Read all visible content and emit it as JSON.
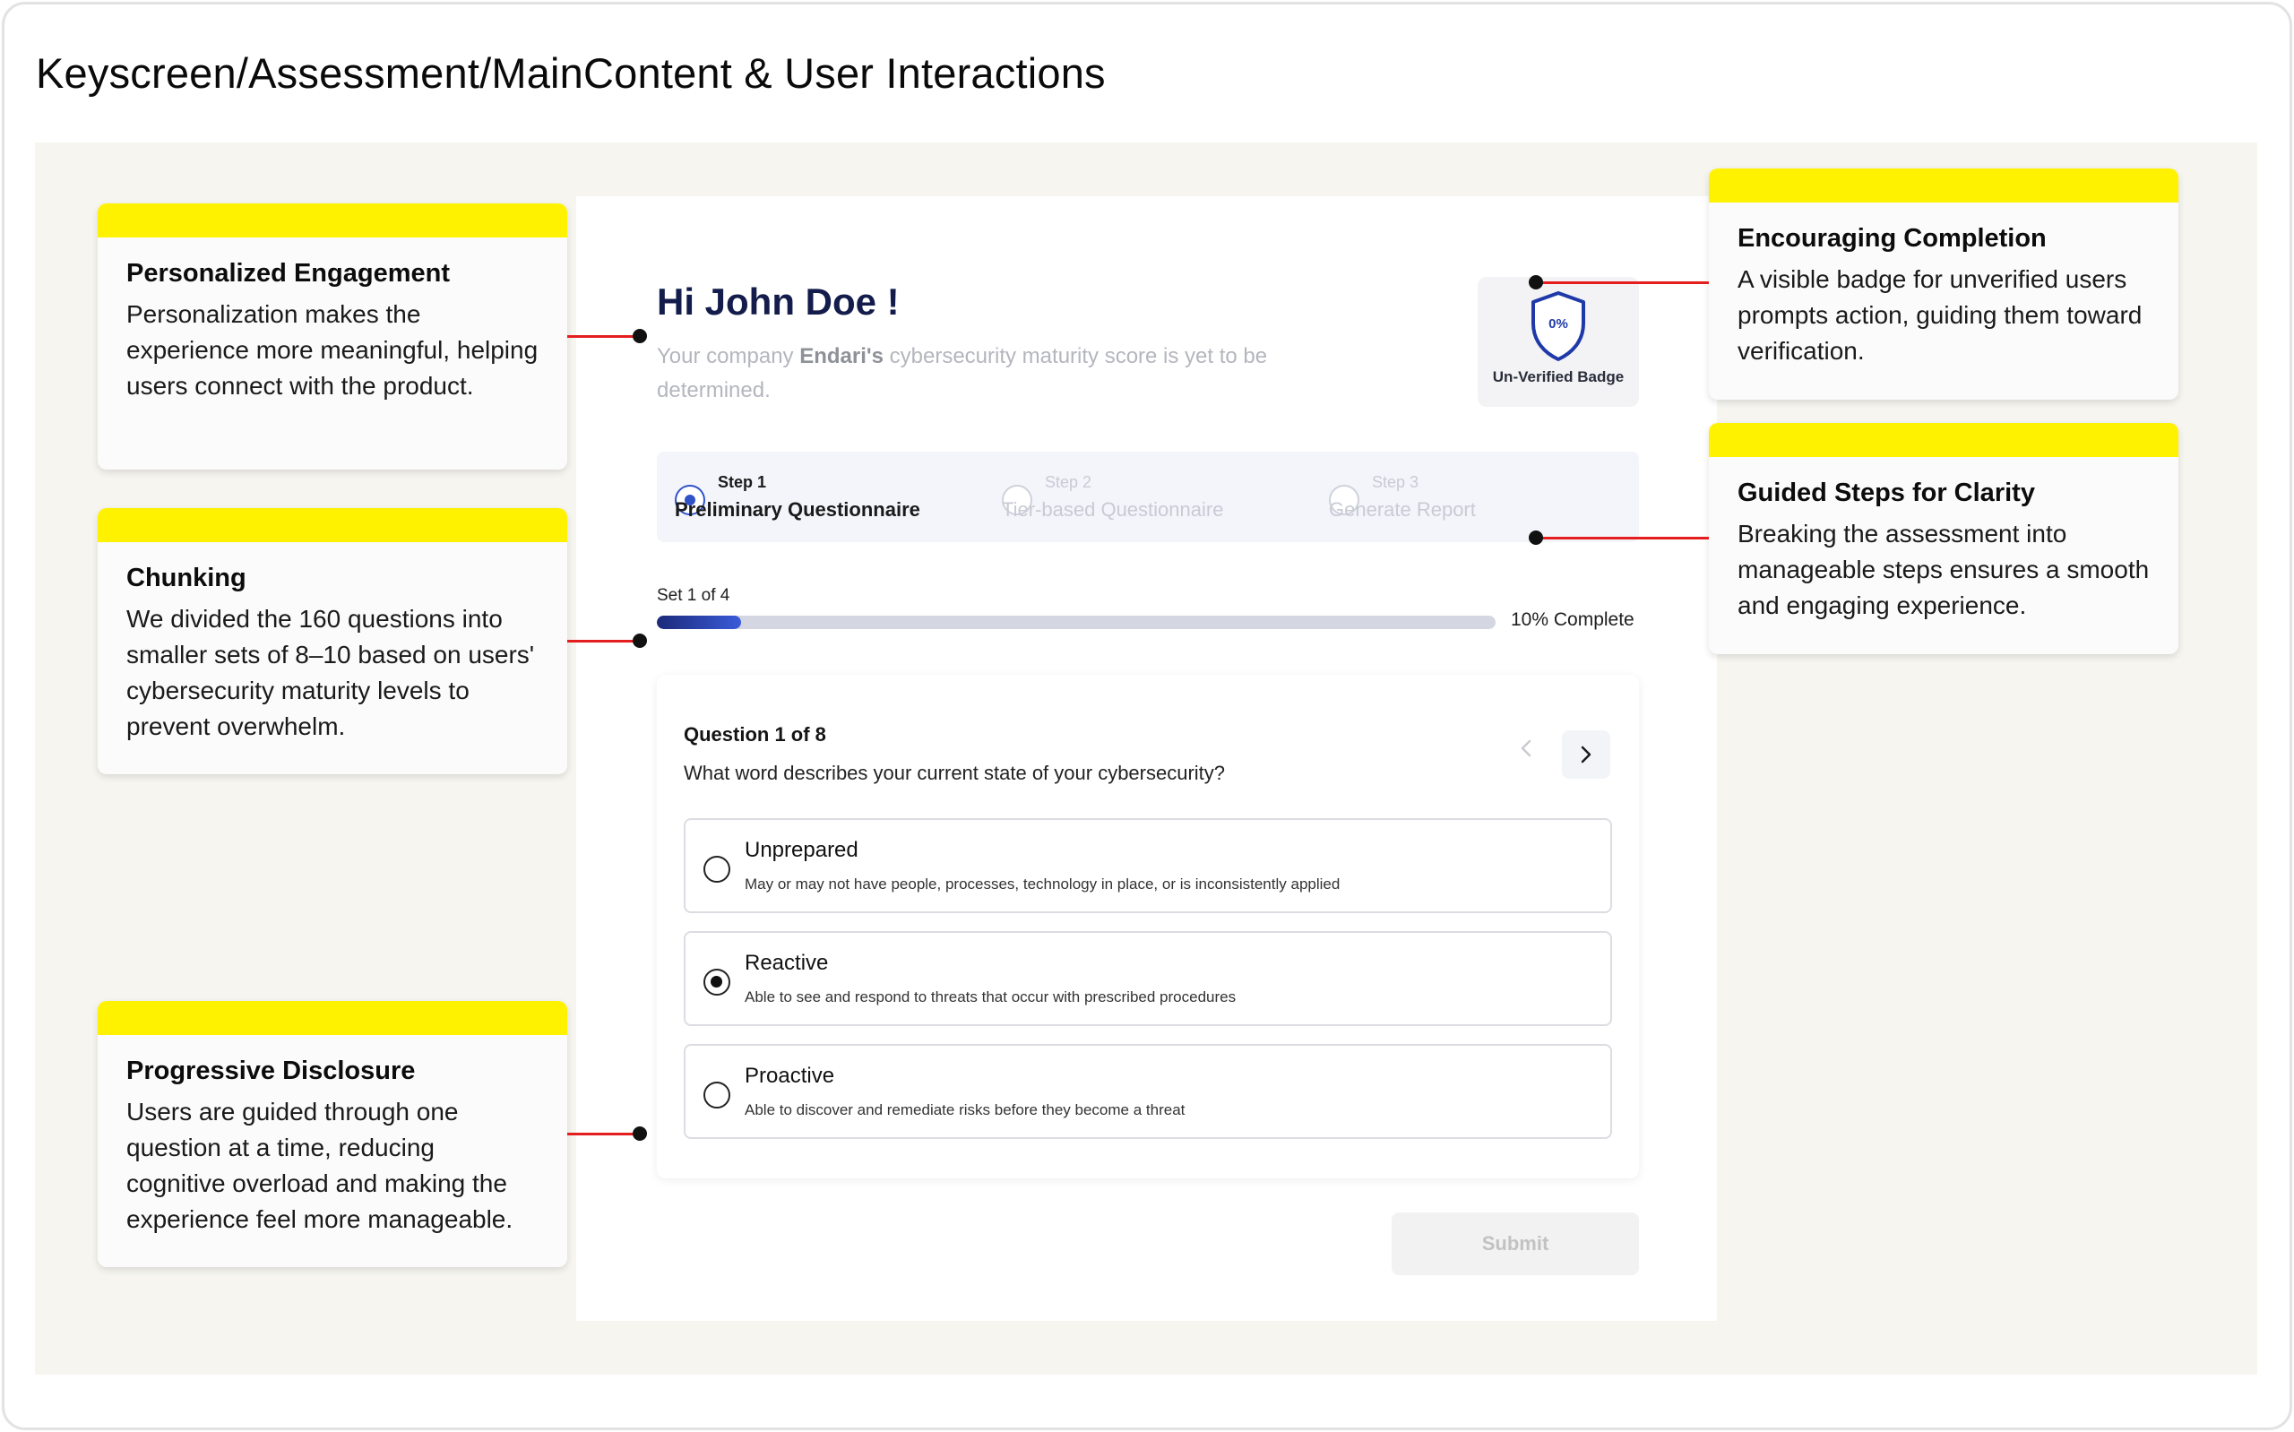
{
  "page": {
    "title": "Keyscreen/Assessment/MainContent & User Interactions"
  },
  "app": {
    "greeting": "Hi John Doe !",
    "company_prefix": "Your company ",
    "company_name": "Endari's",
    "company_suffix": " cybersecurity maturity score is yet to be determined.",
    "badge": {
      "percent": "0%",
      "label": "Un-Verified Badge",
      "icon": "shield-icon"
    },
    "steps": [
      {
        "num": "Step 1",
        "name": "Preliminary Questionnaire",
        "active": true
      },
      {
        "num": "Step  2",
        "name": "Tier-based Questionnaire",
        "active": false
      },
      {
        "num": "Step 3",
        "name": "Generate Report",
        "active": false
      }
    ],
    "progress": {
      "set_label": "Set 1 of 4",
      "percent": 10,
      "complete_label": "10% Complete"
    },
    "question": {
      "count_label": "Question 1 of 8",
      "text": "What word describes your current state of your cybersecurity?",
      "options": [
        {
          "title": "Unprepared",
          "desc": "May or may not have people, processes, technology in place, or is inconsistently applied",
          "selected": false
        },
        {
          "title": "Reactive",
          "desc": "Able to see and respond to threats that occur with prescribed procedures",
          "selected": true
        },
        {
          "title": "Proactive",
          "desc": "Able to discover and remediate risks before they become a threat",
          "selected": false
        }
      ]
    },
    "submit_label": "Submit"
  },
  "notes": {
    "personalized": {
      "title": "Personalized Engagement",
      "body": "Personalization makes the experience more meaningful, helping users connect with the product."
    },
    "chunking": {
      "title": "Chunking",
      "body": "We divided the 160 questions into smaller sets of 8–10 based on users' cybersecurity maturity levels to prevent overwhelm."
    },
    "progressive": {
      "title": "Progressive Disclosure",
      "body": "Users are guided through one question at a time, reducing cognitive overload and making the experience feel more manageable."
    },
    "encouraging": {
      "title": "Encouraging Completion",
      "body": "A visible badge for unverified users prompts action, guiding them toward verification."
    },
    "guided": {
      "title": "Guided Steps for Clarity",
      "body": "Breaking the assessment into manageable steps ensures a smooth and engaging experience."
    }
  },
  "colors": {
    "highlight": "#fff200",
    "connector": "#e41e1e",
    "brand_navy": "#131c4a",
    "accent_blue": "#2f52c9"
  }
}
